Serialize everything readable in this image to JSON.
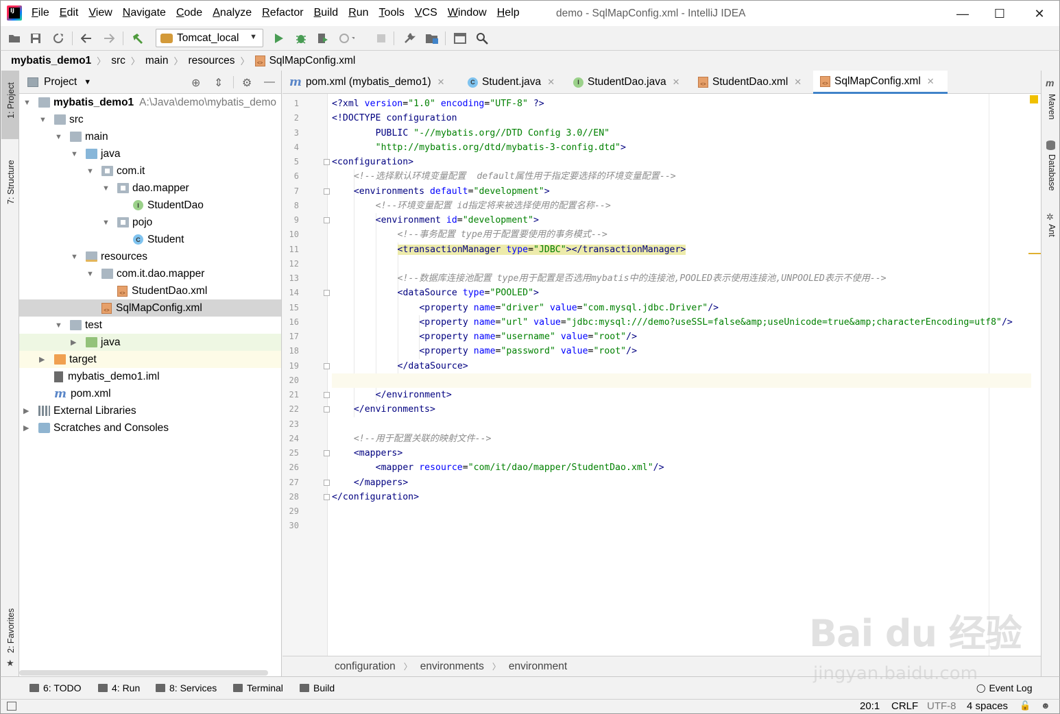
{
  "window": {
    "title": "demo - SqlMapConfig.xml - IntelliJ IDEA",
    "menu": [
      "File",
      "Edit",
      "View",
      "Navigate",
      "Code",
      "Analyze",
      "Refactor",
      "Build",
      "Run",
      "Tools",
      "VCS",
      "Window",
      "Help"
    ],
    "minimize": "—",
    "maximize": "☐",
    "close": "✕"
  },
  "toolbar": {
    "run_config": "Tomcat_local"
  },
  "navbar": {
    "crumbs": [
      "mybatis_demo1",
      "src",
      "main",
      "resources",
      "SqlMapConfig.xml"
    ]
  },
  "left_strip": {
    "project_tab": "1: Project",
    "structure_tab": "7: Structure",
    "favorites_tab": "2: Favorites"
  },
  "right_strip": {
    "maven": "Maven",
    "database": "Database",
    "ant": "Ant"
  },
  "project": {
    "header": "Project",
    "tree": [
      {
        "label": "mybatis_demo1",
        "extra": "A:\\Java\\demo\\mybatis_demo",
        "depth": 0,
        "icon": "module-folder",
        "arrow": "open"
      },
      {
        "label": "src",
        "depth": 1,
        "icon": "folder",
        "arrow": "open"
      },
      {
        "label": "main",
        "depth": 2,
        "icon": "folder",
        "arrow": "open"
      },
      {
        "label": "java",
        "depth": 3,
        "icon": "src-folder",
        "arrow": "open"
      },
      {
        "label": "com.it",
        "depth": 4,
        "icon": "package",
        "arrow": "open"
      },
      {
        "label": "dao.mapper",
        "depth": 5,
        "icon": "package",
        "arrow": "open"
      },
      {
        "label": "StudentDao",
        "depth": 6,
        "icon": "interface"
      },
      {
        "label": "pojo",
        "depth": 5,
        "icon": "package",
        "arrow": "open"
      },
      {
        "label": "Student",
        "depth": 6,
        "icon": "class"
      },
      {
        "label": "resources",
        "depth": 3,
        "icon": "resources-folder",
        "arrow": "open"
      },
      {
        "label": "com.it.dao.mapper",
        "depth": 4,
        "icon": "folder",
        "arrow": "open"
      },
      {
        "label": "StudentDao.xml",
        "depth": 5,
        "icon": "xml"
      },
      {
        "label": "SqlMapConfig.xml",
        "depth": 4,
        "icon": "xml",
        "selected": true
      },
      {
        "label": "test",
        "depth": 2,
        "icon": "folder",
        "arrow": "open"
      },
      {
        "label": "java",
        "depth": 3,
        "icon": "test-folder",
        "arrow": "closed",
        "bg": "test"
      },
      {
        "label": "target",
        "depth": 1,
        "icon": "target-folder",
        "arrow": "closed",
        "bg": "excluded"
      },
      {
        "label": "mybatis_demo1.iml",
        "depth": 1,
        "icon": "iml"
      },
      {
        "label": "pom.xml",
        "depth": 1,
        "icon": "maven"
      },
      {
        "label": "External Libraries",
        "depth": 0,
        "icon": "libraries",
        "arrow": "closed"
      },
      {
        "label": "Scratches and Consoles",
        "depth": 0,
        "icon": "scratches",
        "arrow": "closed"
      }
    ]
  },
  "editor": {
    "tabs": [
      {
        "label": "pom.xml (mybatis_demo1)",
        "icon": "maven"
      },
      {
        "label": "Student.java",
        "icon": "class"
      },
      {
        "label": "StudentDao.java",
        "icon": "interface"
      },
      {
        "label": "StudentDao.xml",
        "icon": "xml"
      },
      {
        "label": "SqlMapConfig.xml",
        "icon": "xml",
        "active": true
      }
    ],
    "line_numbers": [
      "1",
      "2",
      "3",
      "4",
      "5",
      "6",
      "7",
      "8",
      "9",
      "10",
      "11",
      "12",
      "13",
      "14",
      "15",
      "16",
      "17",
      "18",
      "19",
      "20",
      "21",
      "22",
      "23",
      "24",
      "25",
      "26",
      "27",
      "28",
      "29",
      "30"
    ],
    "lines": [
      {
        "indent": 0,
        "tokens": [
          [
            "t",
            "<?"
          ],
          [
            "t",
            "xml "
          ],
          [
            "a",
            "version"
          ],
          [
            "p",
            "="
          ],
          [
            "v",
            "\"1.0\" "
          ],
          [
            "a",
            "encoding"
          ],
          [
            "p",
            "="
          ],
          [
            "v",
            "\"UTF-8\" "
          ],
          [
            "t",
            "?>"
          ]
        ]
      },
      {
        "indent": 0,
        "tokens": [
          [
            "t",
            "<!DOCTYPE configuration"
          ]
        ]
      },
      {
        "indent": 8,
        "tokens": [
          [
            "t",
            "PUBLIC "
          ],
          [
            "v",
            "\"-//mybatis.org//DTD Config 3.0//EN\""
          ]
        ]
      },
      {
        "indent": 8,
        "tokens": [
          [
            "v",
            "\"http://mybatis.org/dtd/mybatis-3-config.dtd\""
          ],
          [
            "t",
            ">"
          ]
        ]
      },
      {
        "indent": 0,
        "tokens": [
          [
            "t",
            "<configuration>"
          ]
        ]
      },
      {
        "indent": 4,
        "tokens": [
          [
            "c",
            "<!--选择默认环境变量配置  default属性用于指定要选择的环境变量配置-->"
          ]
        ]
      },
      {
        "indent": 4,
        "tokens": [
          [
            "t",
            "<environments "
          ],
          [
            "a",
            "default"
          ],
          [
            "p",
            "="
          ],
          [
            "v",
            "\"development\""
          ],
          [
            "t",
            ">"
          ]
        ]
      },
      {
        "indent": 8,
        "tokens": [
          [
            "c",
            "<!--环境变量配置 id指定将来被选择使用的配置名称-->"
          ]
        ]
      },
      {
        "indent": 8,
        "tokens": [
          [
            "t",
            "<environment "
          ],
          [
            "a",
            "id"
          ],
          [
            "p",
            "="
          ],
          [
            "v",
            "\"development\""
          ],
          [
            "t",
            ">"
          ]
        ]
      },
      {
        "indent": 12,
        "tokens": [
          [
            "c",
            "<!--事务配置 type用于配置要使用的事务模式-->"
          ]
        ]
      },
      {
        "indent": 12,
        "tokens": [
          [
            "t",
            "<transactionManager "
          ],
          [
            "a",
            "type"
          ],
          [
            "p",
            "="
          ],
          [
            "v",
            "\"JDBC\""
          ],
          [
            "t",
            "></transactionManager>"
          ]
        ],
        "highlight": true
      },
      {
        "indent": 0,
        "tokens": []
      },
      {
        "indent": 12,
        "tokens": [
          [
            "c",
            "<!--数据库连接池配置 type用于配置是否选用mybatis中的连接池,POOLED表示使用连接池,UNPOOLED表示不使用-->"
          ]
        ]
      },
      {
        "indent": 12,
        "tokens": [
          [
            "t",
            "<dataSource "
          ],
          [
            "a",
            "type"
          ],
          [
            "p",
            "="
          ],
          [
            "v",
            "\"POOLED\""
          ],
          [
            "t",
            ">"
          ]
        ]
      },
      {
        "indent": 16,
        "tokens": [
          [
            "t",
            "<property "
          ],
          [
            "a",
            "name"
          ],
          [
            "p",
            "="
          ],
          [
            "v",
            "\"driver\" "
          ],
          [
            "a",
            "value"
          ],
          [
            "p",
            "="
          ],
          [
            "v",
            "\"com.mysql.jdbc.Driver\""
          ],
          [
            "t",
            "/>"
          ]
        ]
      },
      {
        "indent": 16,
        "tokens": [
          [
            "t",
            "<property "
          ],
          [
            "a",
            "name"
          ],
          [
            "p",
            "="
          ],
          [
            "v",
            "\"url\" "
          ],
          [
            "a",
            "value"
          ],
          [
            "p",
            "="
          ],
          [
            "v",
            "\"jdbc:mysql:///demo?useSSL=false&amp;useUnicode=true&amp;characterEncoding=utf8\""
          ],
          [
            "t",
            "/>"
          ]
        ]
      },
      {
        "indent": 16,
        "tokens": [
          [
            "t",
            "<property "
          ],
          [
            "a",
            "name"
          ],
          [
            "p",
            "="
          ],
          [
            "v",
            "\"username\" "
          ],
          [
            "a",
            "value"
          ],
          [
            "p",
            "="
          ],
          [
            "v",
            "\"root\""
          ],
          [
            "t",
            "/>"
          ]
        ]
      },
      {
        "indent": 16,
        "tokens": [
          [
            "t",
            "<property "
          ],
          [
            "a",
            "name"
          ],
          [
            "p",
            "="
          ],
          [
            "v",
            "\"password\" "
          ],
          [
            "a",
            "value"
          ],
          [
            "p",
            "="
          ],
          [
            "v",
            "\"root\""
          ],
          [
            "t",
            "/>"
          ]
        ]
      },
      {
        "indent": 12,
        "tokens": [
          [
            "t",
            "</dataSource>"
          ]
        ]
      },
      {
        "indent": 0,
        "tokens": [],
        "caret": true
      },
      {
        "indent": 8,
        "tokens": [
          [
            "t",
            "</environment>"
          ]
        ]
      },
      {
        "indent": 4,
        "tokens": [
          [
            "t",
            "</environments>"
          ]
        ]
      },
      {
        "indent": 0,
        "tokens": []
      },
      {
        "indent": 4,
        "tokens": [
          [
            "c",
            "<!--用于配置关联的映射文件-->"
          ]
        ]
      },
      {
        "indent": 4,
        "tokens": [
          [
            "t",
            "<mappers>"
          ]
        ]
      },
      {
        "indent": 8,
        "tokens": [
          [
            "t",
            "<mapper "
          ],
          [
            "a",
            "resource"
          ],
          [
            "p",
            "="
          ],
          [
            "v",
            "\"com/it/dao/mapper/StudentDao.xml\""
          ],
          [
            "t",
            "/>"
          ]
        ]
      },
      {
        "indent": 4,
        "tokens": [
          [
            "t",
            "</mappers>"
          ]
        ]
      },
      {
        "indent": 0,
        "tokens": [
          [
            "t",
            "</configuration>"
          ]
        ]
      },
      {
        "indent": 0,
        "tokens": []
      },
      {
        "indent": 0,
        "tokens": []
      }
    ],
    "breadcrumbs": [
      "configuration",
      "environments",
      "environment"
    ]
  },
  "bottom_tools": [
    {
      "label": "6: TODO"
    },
    {
      "label": "4: Run"
    },
    {
      "label": "8: Services"
    },
    {
      "label": "Terminal"
    },
    {
      "label": "Build"
    }
  ],
  "event_log": "Event Log",
  "status": {
    "position": "20:1",
    "line_sep": "CRLF",
    "encoding": "UTF-8",
    "indent": "4 spaces"
  },
  "watermark": {
    "main": "Bai du 经验",
    "url": "jingyan.baidu.com"
  }
}
